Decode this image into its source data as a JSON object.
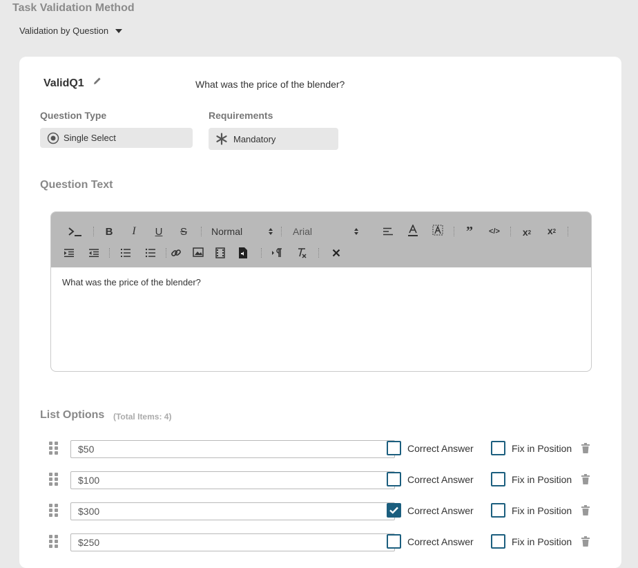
{
  "method": {
    "title": "Task Validation Method",
    "selected": "Validation by Question"
  },
  "question": {
    "name": "ValidQ1",
    "preview_text": "What was the price of the blender?",
    "type_label": "Question Type",
    "type_value": "Single Select",
    "requirements_label": "Requirements",
    "requirements_value": "Mandatory"
  },
  "question_text": {
    "title": "Question Text",
    "format_value": "Normal",
    "font_value": "Arial",
    "body": "What was the price of the blender?"
  },
  "list_options": {
    "title": "List Options",
    "count_text": "(Total Items: 4)",
    "correct_label": "Correct Answer",
    "fix_label": "Fix in Position",
    "items": [
      {
        "value": "$50",
        "correct": false,
        "fixed": false
      },
      {
        "value": "$100",
        "correct": false,
        "fixed": false
      },
      {
        "value": "$300",
        "correct": true,
        "fixed": false
      },
      {
        "value": "$250",
        "correct": false,
        "fixed": false
      }
    ]
  },
  "colors": {
    "accent": "#1b5e7e",
    "toolbar": "#b9b9b9",
    "page_bg": "#e9e9e9"
  }
}
